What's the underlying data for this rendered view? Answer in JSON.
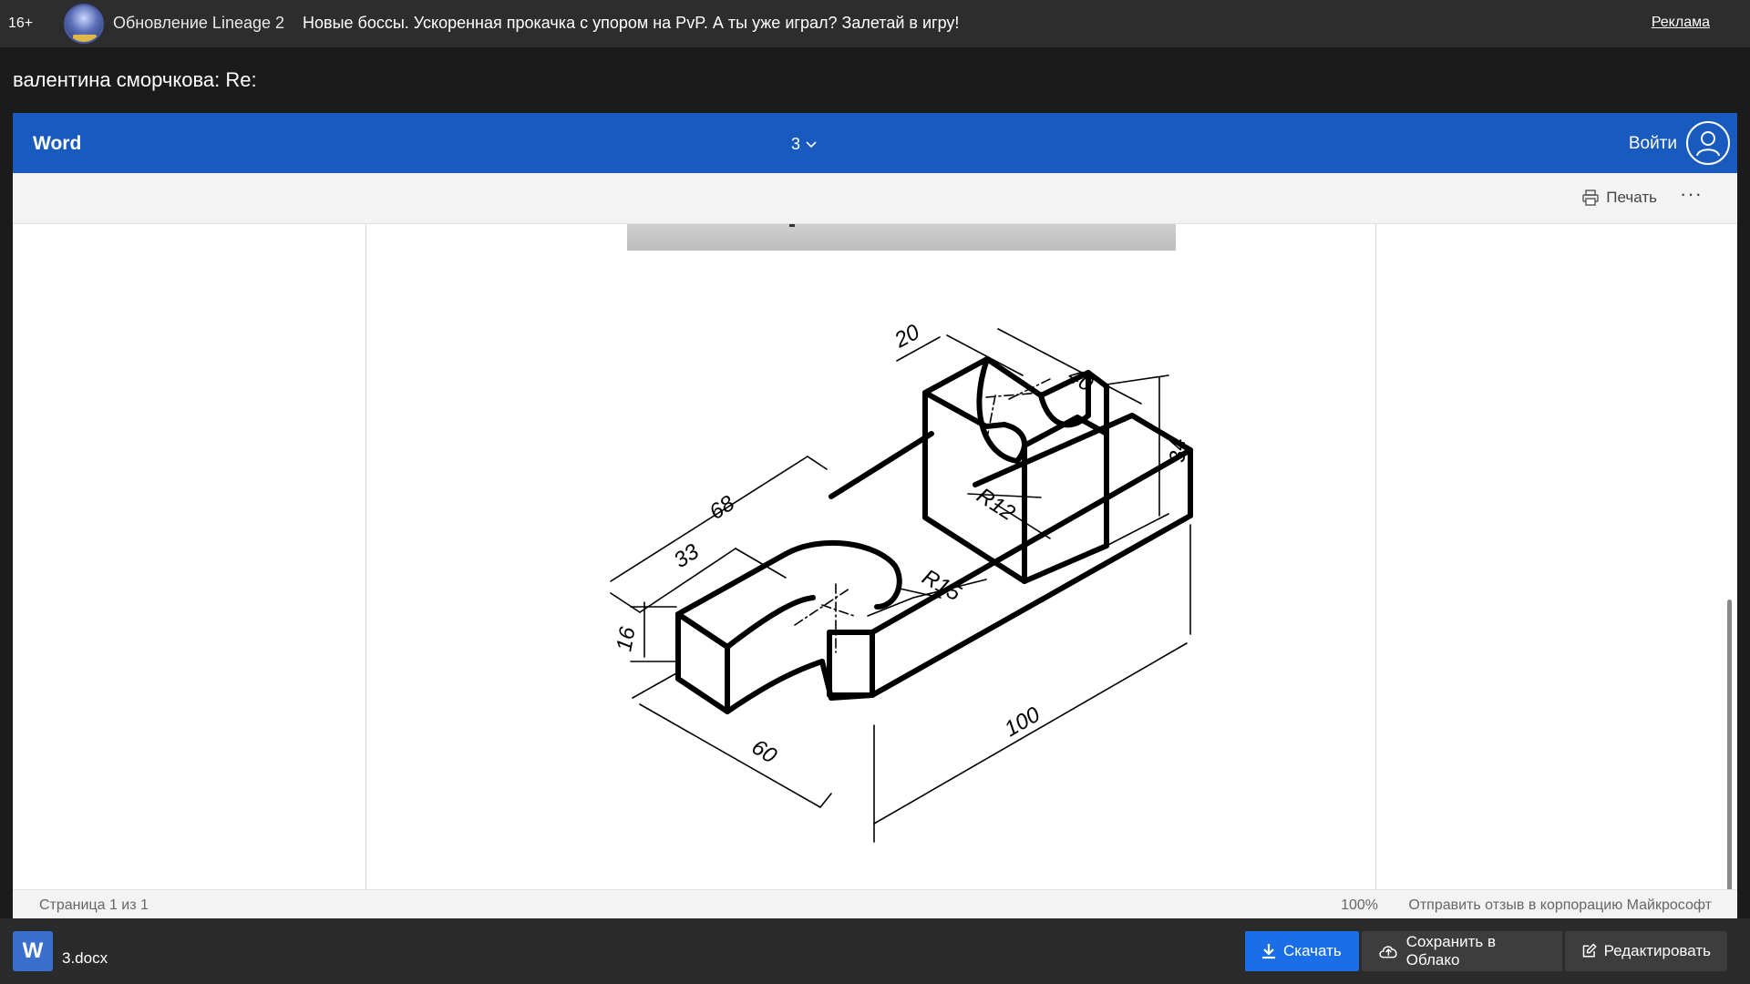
{
  "ad": {
    "age_rating": "16+",
    "source": "Обновление Lineage 2",
    "text": "Новые боссы. Ускоренная прокачка с упором на PvP. А ты уже играл? Залетай в игру!",
    "link": "Реклама"
  },
  "message": {
    "sender_line": "валентина сморчкова: Re:"
  },
  "word": {
    "app_title": "Word",
    "doc_name": "3",
    "signin": "Войти",
    "print": "Печать",
    "more": "···",
    "drawing_labels": {
      "d20": "20",
      "d40": "40",
      "d34": "34",
      "r12": "R12",
      "d68": "68",
      "d33": "33",
      "r15": "R15",
      "d16": "16",
      "d60": "60",
      "d100": "100"
    },
    "status": {
      "page_count": "Страница 1 из 1",
      "zoom": "100%",
      "feedback": "Отправить отзыв в корпорацию Майкрософт"
    }
  },
  "attachment": {
    "file_icon_letter": "W",
    "file_name": "3.docx",
    "download": "Скачать",
    "save_cloud": "Сохранить в Облако",
    "edit": "Редактировать"
  }
}
